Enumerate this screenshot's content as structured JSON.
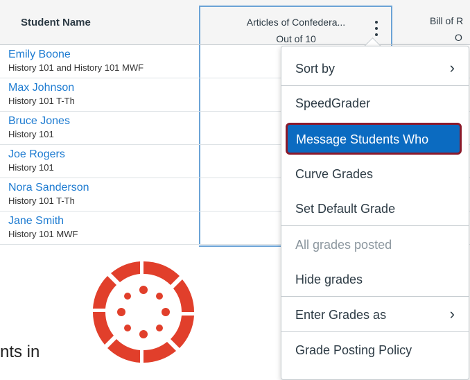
{
  "grid": {
    "header": {
      "name_label": "Student Name",
      "assignment_title": "Articles of Confedera...",
      "assignment_points": "Out of 10",
      "next_title": "Bill of R",
      "next_points": "O"
    },
    "students": [
      {
        "name": "Emily Boone",
        "section": "History 101 and History 101 MWF"
      },
      {
        "name": "Max Johnson",
        "section": "History 101 T-Th"
      },
      {
        "name": "Bruce Jones",
        "section": "History 101"
      },
      {
        "name": "Joe Rogers",
        "section": "History 101"
      },
      {
        "name": "Nora Sanderson",
        "section": "History 101 T-Th"
      },
      {
        "name": "Jane Smith",
        "section": "History 101 MWF"
      }
    ]
  },
  "background_text": "nts in",
  "menu": {
    "items": [
      {
        "label": "Sort by",
        "submenu": true
      },
      {
        "label": "SpeedGrader"
      },
      {
        "label": "Message Students Who",
        "highlighted": true
      },
      {
        "label": "Curve Grades"
      },
      {
        "label": "Set Default Grade"
      },
      {
        "label": "All grades posted",
        "disabled": true
      },
      {
        "label": "Hide grades"
      },
      {
        "label": "Enter Grades as",
        "submenu": true
      },
      {
        "label": "Grade Posting Policy"
      }
    ]
  },
  "icons": {
    "kebab": "vertical-ellipsis-icon",
    "chevron": "chevron-right-icon",
    "logo": "canvas-logo"
  },
  "colors": {
    "link": "#1d7bd1",
    "selected_column": "#6ba3d6",
    "highlight_bg": "#0b6bc1",
    "highlight_border": "#8b1a2b",
    "logo": "#e13f2b"
  }
}
